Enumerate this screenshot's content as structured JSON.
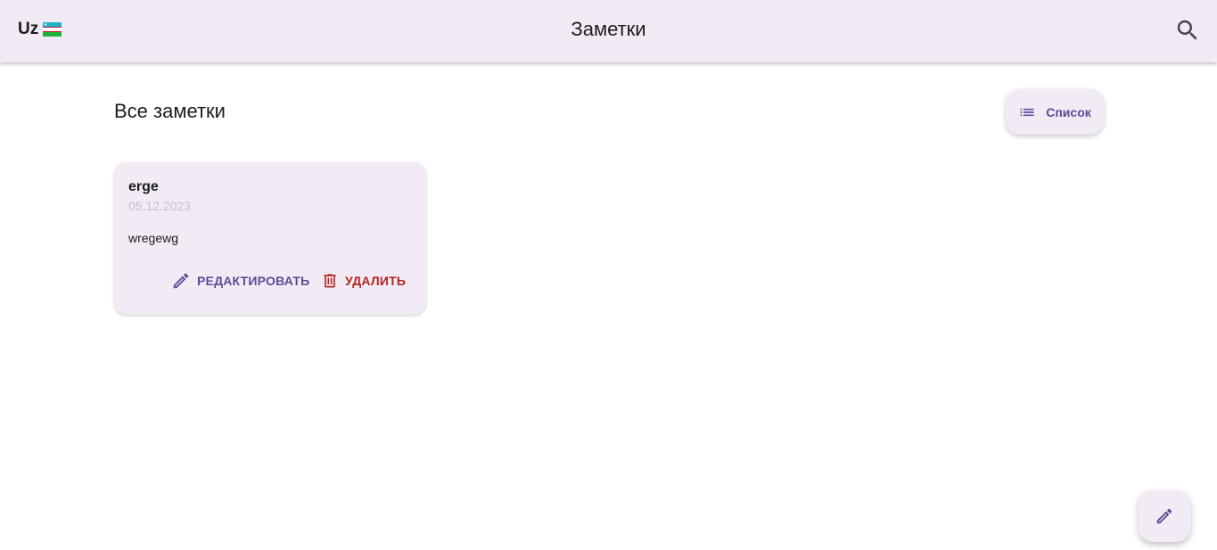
{
  "appbar": {
    "language_code": "Uz",
    "language_flag_icon": "uzbekistan-flag-icon",
    "title": "Заметки",
    "search_icon": "search-icon"
  },
  "main": {
    "section_title": "Все заметки",
    "view_toggle": {
      "icon": "list-icon",
      "label": "Список"
    }
  },
  "notes": [
    {
      "title": "erge",
      "date": "05.12.2023",
      "body": "wregewg",
      "edit_label": "РЕДАКТИРОВАТЬ",
      "edit_icon": "pencil-icon",
      "delete_label": "УДАЛИТЬ",
      "delete_icon": "trash-icon"
    }
  ],
  "fab": {
    "icon": "pencil-icon"
  },
  "colors": {
    "surface": "#f2ebf6",
    "primary": "#5e4a94",
    "error": "#b3261e",
    "date_text": "#c6bfcc"
  }
}
